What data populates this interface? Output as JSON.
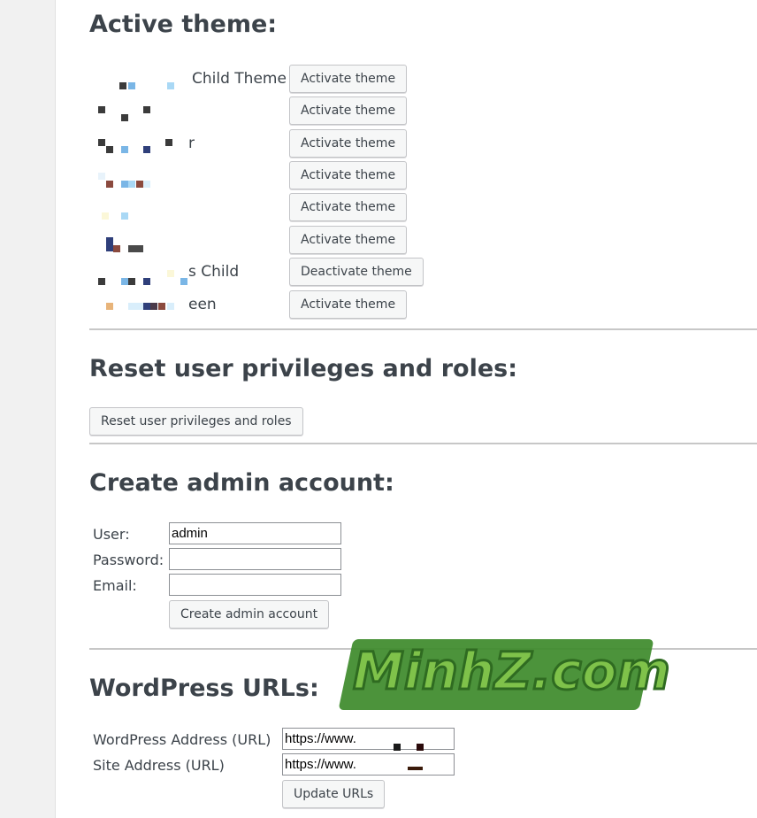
{
  "active_theme": {
    "heading": "Active theme:",
    "themes": [
      {
        "name": "Child Theme",
        "action": "Activate theme"
      },
      {
        "name": "",
        "action": "Activate theme"
      },
      {
        "name": "r",
        "action": "Activate theme"
      },
      {
        "name": "",
        "action": "Activate theme"
      },
      {
        "name": "",
        "action": "Activate theme"
      },
      {
        "name": "",
        "action": "Activate theme"
      },
      {
        "name": "s Child",
        "action": "Deactivate theme"
      },
      {
        "name": "een",
        "action": "Activate theme"
      }
    ]
  },
  "reset_roles": {
    "heading": "Reset user privileges and roles:",
    "button": "Reset user privileges and roles"
  },
  "create_admin": {
    "heading": "Create admin account:",
    "user_label": "User:",
    "user_value": "admin",
    "password_label": "Password:",
    "password_value": "",
    "email_label": "Email:",
    "email_value": "",
    "button": "Create admin account"
  },
  "wp_urls": {
    "heading": "WordPress URLs:",
    "wp_address_label": "WordPress Address (URL)",
    "wp_address_value": "https://www.",
    "site_address_label": "Site Address (URL)",
    "site_address_value": "https://www.",
    "button": "Update URLs"
  },
  "watermark": {
    "text": "MinhZ.com"
  },
  "colors": {
    "accent_green": "#7fc24a",
    "button_bg": "#f6f7f7",
    "text": "#3c434a"
  }
}
